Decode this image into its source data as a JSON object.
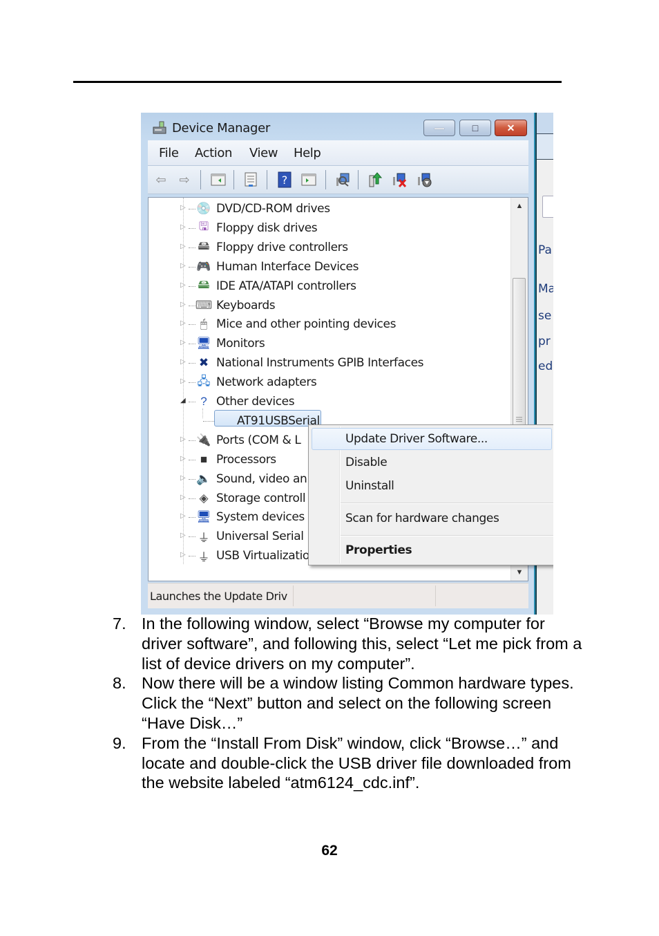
{
  "window": {
    "title": "Device Manager",
    "menus": [
      "File",
      "Action",
      "View",
      "Help"
    ],
    "caption_buttons": {
      "minimize": "—",
      "maximize": "□",
      "close": "✕"
    },
    "toolbar_icons": [
      "back-icon",
      "forward-icon",
      "show-hide-console-tree-icon",
      "properties-icon",
      "help-icon",
      "show-action-pane-icon",
      "scan-hardware-icon",
      "update-driver-icon",
      "uninstall-icon",
      "disable-icon"
    ],
    "tree": [
      {
        "label": "DVD/CD-ROM drives",
        "icon": "dvd-drive-icon",
        "glyph": "💿",
        "state": "collapsed"
      },
      {
        "label": "Floppy disk drives",
        "icon": "floppy-disk-icon",
        "glyph": "🖫",
        "state": "collapsed"
      },
      {
        "label": "Floppy drive controllers",
        "icon": "floppy-controller-icon",
        "glyph": "🖴",
        "state": "collapsed"
      },
      {
        "label": "Human Interface Devices",
        "icon": "hid-icon",
        "glyph": "🎮",
        "state": "collapsed"
      },
      {
        "label": "IDE ATA/ATAPI controllers",
        "icon": "ide-controller-icon",
        "glyph": "🖴",
        "state": "collapsed"
      },
      {
        "label": "Keyboards",
        "icon": "keyboard-icon",
        "glyph": "⌨",
        "state": "collapsed"
      },
      {
        "label": "Mice and other pointing devices",
        "icon": "mouse-icon",
        "glyph": "🖱",
        "state": "collapsed"
      },
      {
        "label": "Monitors",
        "icon": "monitor-icon",
        "glyph": "🖥",
        "state": "collapsed"
      },
      {
        "label": "National Instruments GPIB Interfaces",
        "icon": "national-instruments-icon",
        "glyph": "✖",
        "state": "collapsed"
      },
      {
        "label": "Network adapters",
        "icon": "network-adapter-icon",
        "glyph": "🖧",
        "state": "collapsed"
      },
      {
        "label": "Other devices",
        "icon": "unknown-device-icon",
        "glyph": "?",
        "state": "expanded"
      },
      {
        "label": "AT91USBSerial",
        "icon": "warning-device-icon",
        "glyph": "⚠",
        "state": "child-selected"
      },
      {
        "label": "Ports (COM & L",
        "icon": "port-icon",
        "glyph": "🔌",
        "state": "collapsed"
      },
      {
        "label": "Processors",
        "icon": "processor-icon",
        "glyph": "■",
        "state": "collapsed"
      },
      {
        "label": "Sound, video an",
        "icon": "speaker-icon",
        "glyph": "🔈",
        "state": "collapsed"
      },
      {
        "label": "Storage controll",
        "icon": "storage-controller-icon",
        "glyph": "◈",
        "state": "collapsed"
      },
      {
        "label": "System devices",
        "icon": "system-device-icon",
        "glyph": "🖥",
        "state": "collapsed"
      },
      {
        "label": "Universal Serial E",
        "icon": "usb-icon",
        "glyph": "⏚",
        "state": "collapsed"
      },
      {
        "label": "USB Virtualizatio",
        "icon": "usb-icon",
        "glyph": "⏚",
        "state": "collapsed"
      }
    ],
    "context_menu": {
      "items": [
        "Update Driver Software...",
        "Disable",
        "Uninstall",
        "Scan for hardware changes",
        "Properties"
      ],
      "highlighted": "Update Driver Software..."
    },
    "status_text": "Launches the Update Driv"
  },
  "background_window_fragments": [
    "Pa",
    "Ma",
    "se",
    "pr",
    "ed"
  ],
  "steps": [
    {
      "num": "7.",
      "text": "In the following window, select “Browse my computer for driver software”, and following this, select “Let me pick from a list of device drivers on my computer”."
    },
    {
      "num": "8.",
      "text": "Now there will be a window listing Common hardware types.  Click the “Next” button and select on the following screen “Have Disk…”"
    },
    {
      "num": "9.",
      "text": "From the “Install From Disk” window, click “Browse…” and locate and double-click the USB driver file downloaded from the website labeled “atm6124_cdc.inf”."
    }
  ],
  "page_number": "62"
}
